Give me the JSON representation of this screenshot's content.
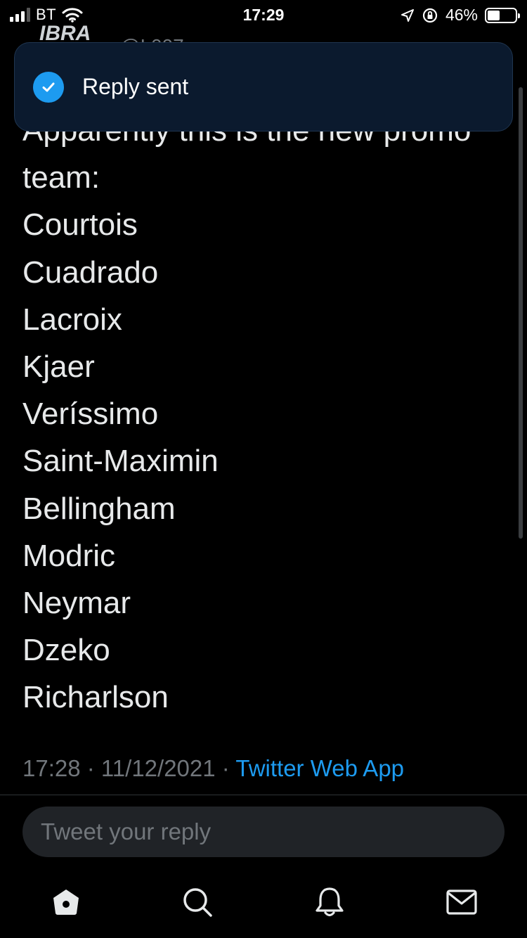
{
  "status_bar": {
    "carrier": "BT",
    "time": "17:29",
    "battery": "46%",
    "battery_level": 0.46,
    "signal_bars_filled": 3
  },
  "header": {
    "logo_text": "IBRA",
    "handle_fragment": "@I   007"
  },
  "toast": {
    "message": "Reply sent",
    "icon": "check-circle-icon",
    "color": "#1d9bf0"
  },
  "tweet": {
    "lines": [
      "Apparently this is the new promo",
      "team:",
      "Courtois",
      "Cuadrado",
      "Lacroix",
      "Kjaer",
      "Veríssimo",
      "Saint-Maximin",
      "Bellingham",
      "Modric",
      "Neymar",
      "Dzeko",
      "Richarlson"
    ],
    "timestamp": "17:28 · 11/12/2021 · ",
    "source": "Twitter Web App"
  },
  "reply": {
    "placeholder": "Tweet your reply"
  },
  "nav": {
    "items": [
      "home-icon",
      "search-icon",
      "notifications-bell-icon",
      "messages-envelope-icon"
    ]
  },
  "colors": {
    "background": "#000000",
    "accent": "#1d9bf0",
    "secondary_text": "#71767b"
  }
}
